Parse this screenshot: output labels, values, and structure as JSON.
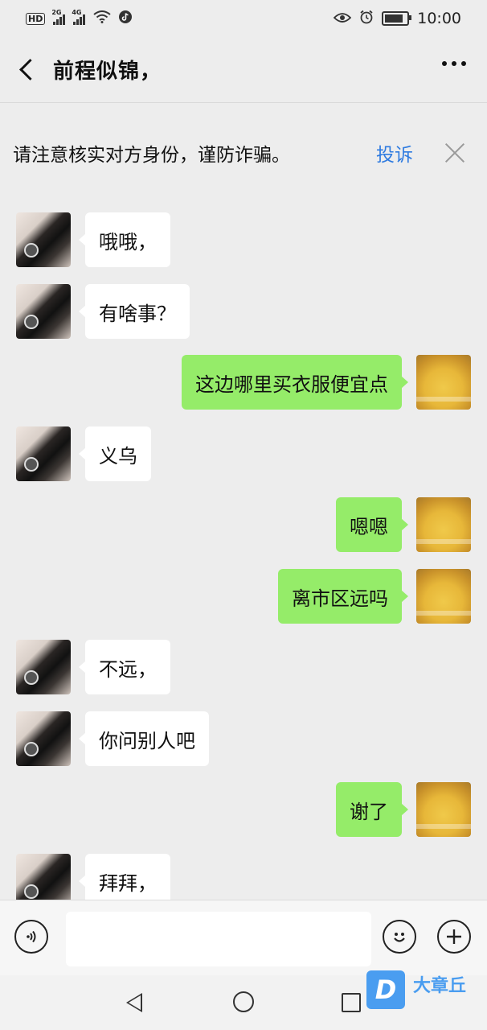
{
  "status_bar": {
    "left_icons": [
      "hd-icon",
      "signal-2g-icon",
      "signal-4g-icon",
      "wifi-icon",
      "tiktok-icon"
    ],
    "hd_label": "HD",
    "net1_label": "2G",
    "net2_label": "4G",
    "right_icons": [
      "eye-icon",
      "alarm-icon",
      "battery-icon"
    ],
    "time": "10:00"
  },
  "header": {
    "title": "前程似锦，"
  },
  "warning": {
    "text": "请注意核实对方身份，谨防诈骗。",
    "report_label": "投诉"
  },
  "messages": [
    {
      "side": "left",
      "text": "哦哦，"
    },
    {
      "side": "left",
      "text": "有啥事？"
    },
    {
      "side": "right",
      "text": "这边哪里买衣服便宜点"
    },
    {
      "side": "left",
      "text": "义乌"
    },
    {
      "side": "right",
      "text": "嗯嗯"
    },
    {
      "side": "right",
      "text": "离市区远吗"
    },
    {
      "side": "left",
      "text": "不远，"
    },
    {
      "side": "left",
      "text": "你问别人吧"
    },
    {
      "side": "right",
      "text": "谢了"
    },
    {
      "side": "left",
      "text": "拜拜，"
    }
  ],
  "input_bar": {
    "placeholder": "",
    "icons": [
      "voice-icon",
      "emoji-icon",
      "plus-icon"
    ]
  },
  "nav_bar": {
    "icons": [
      "nav-back-icon",
      "nav-home-icon",
      "nav-recent-icon"
    ]
  },
  "watermark": {
    "logo_letter": "D",
    "text": "大章丘"
  }
}
